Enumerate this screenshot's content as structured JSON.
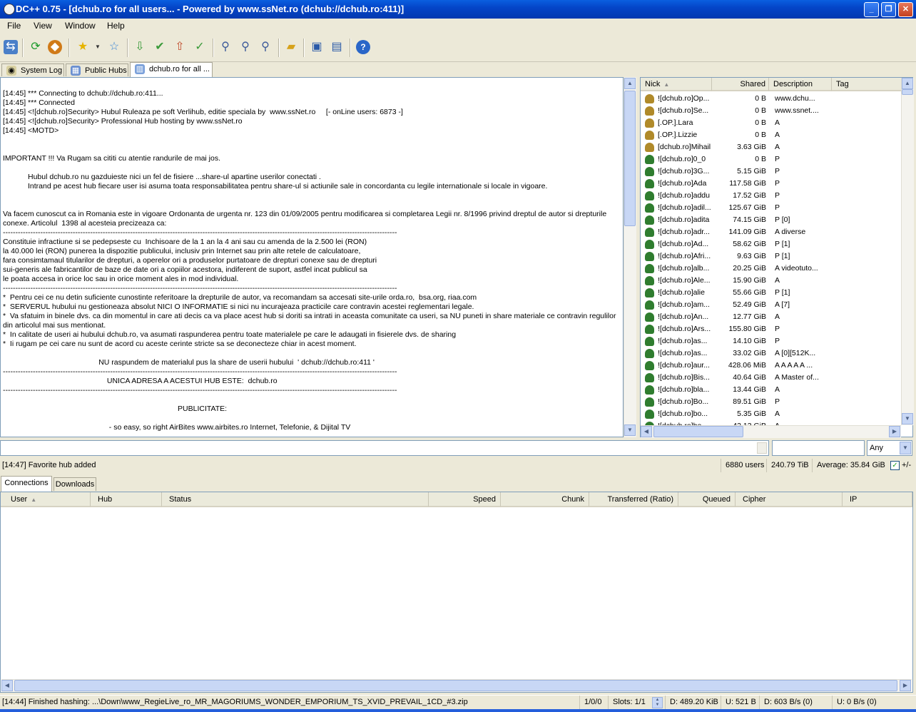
{
  "window": {
    "title": "DC++ 0.75 - [dchub.ro for all users... - Powered by www.ssNet.ro  (dchub://dchub.ro:411)]",
    "minimize": "_",
    "restore": "❐",
    "close": "✕"
  },
  "menu": [
    "File",
    "View",
    "Window",
    "Help"
  ],
  "tabs": [
    {
      "label": "System Log",
      "icon": "log-icon"
    },
    {
      "label": "Public Hubs",
      "icon": "hubs-icon"
    },
    {
      "label": "dchub.ro for all ...",
      "icon": "hub-icon"
    }
  ],
  "chat": {
    "lines": [
      "[14:45] *** Connecting to dchub://dchub.ro:411...",
      "[14:45] *** Connected",
      "[14:45] <![dchub.ro]Security> Hubul Ruleaza pe soft Verlihub, editie speciala by  www.ssNet.ro     [- onLine users: 6873 -]",
      "[14:45] <![dchub.ro]Security> Professional Hub hosting by www.ssNet.ro",
      "[14:45] <MOTD>",
      "",
      "IMPORTANT !!! Va Rugam sa cititi cu atentie randurile de mai jos.",
      "",
      "            Hubul dchub.ro nu gazduieste nici un fel de fisiere ...share-ul apartine userilor conectati .",
      "            Intrand pe acest hub fiecare user isi asuma toata responsabilitatea pentru share-ul si actiunile sale in concordanta cu legile internationale si locale in vigoare.",
      "",
      "",
      "Va facem cunoscut ca in Romania este in vigoare Ordonanta de urgenta nr. 123 din 01/09/2005 pentru modificarea si completarea Legii nr. 8/1996 privind dreptul de autor si drepturile",
      "conexe. Articolul  1398 al acesteia precizeaza ca:",
      "--------------------------------------------------------------------------------------------------------------------------------------------------------------",
      "Constituie infractiune si se pedepseste cu  Inchisoare de la 1 an la 4 ani sau cu amenda de la 2.500 lei (RON)",
      "la 40.000 lei (RON) punerea la dispozitie publicului, inclusiv prin Internet sau prin alte retele de calculatoare,",
      "fara consimtamaul titularilor de drepturi, a operelor ori a produselor purtatoare de drepturi conexe sau de drepturi",
      "sui-generis ale fabricantilor de baze de date ori a copiilor acestora, indiferent de suport, astfel incat publicul sa",
      "le poata accesa in orice loc sau in orice moment ales in mod individual.",
      "--------------------------------------------------------------------------------------------------------------------------------------------------------------",
      "*  Pentru cei ce nu detin suficiente cunostinte referitoare la drepturile de autor, va recomandam sa accesati site-urile orda.ro,  bsa.org, riaa.com",
      "*  SERVERUL hubului nu gestioneaza absolut NICI O INFORMATIE si nici nu incurajeaza practicile care contravin acestei reglementari legale.",
      "*  Va sfatuim in binele dvs. ca din momentul in care ati decis ca va place acest hub si doriti sa intrati in aceasta comunitate ca useri, sa NU puneti in share materiale ce contravin regulilor",
      "din articolul mai sus mentionat.",
      "*  In calitate de useri ai hubului dchub.ro, va asumati raspunderea pentru toate materialele pe care le adaugati in fisierele dvs. de sharing",
      "*  Ii rugam pe cei care nu sunt de acord cu aceste cerinte stricte sa se deconecteze chiar in acest moment.",
      "",
      "                                              NU raspundem de materialul pus la share de userii hubului  ' dchub://dchub.ro:411 '",
      "--------------------------------------------------------------------------------------------------------------------------------------------------------------",
      "                                                  UNICA ADRESA A ACESTUI HUB ESTE:  dchub.ro",
      "--------------------------------------------------------------------------------------------------------------------------------------------------------------",
      "",
      "                                                                                    PUBLICITATE:",
      "",
      "                                                   - so easy, so right AirBites www.airbites.ro Internet, Telefonie, & Dijital TV"
    ]
  },
  "userlist": {
    "columns": [
      "Nick",
      "Shared",
      "Description",
      "Tag"
    ],
    "rows": [
      {
        "nick": "![dchub.ro]Op...",
        "shared": "0 B",
        "desc": "www.dchu...",
        "op": true
      },
      {
        "nick": "![dchub.ro]Se...",
        "shared": "0 B",
        "desc": "www.ssnet....",
        "op": true
      },
      {
        "nick": "[.OP.].Lara",
        "shared": "0 B",
        "desc": "A",
        "op": true
      },
      {
        "nick": "[.OP.].Lizzie",
        "shared": "0 B",
        "desc": "A",
        "op": true
      },
      {
        "nick": "[dchub.ro]Mihail",
        "shared": "3.63 GiB",
        "desc": "A",
        "op": true
      },
      {
        "nick": "![dchub.ro]0_0",
        "shared": "0 B",
        "desc": "P",
        "op": false
      },
      {
        "nick": "![dchub.ro]3G...",
        "shared": "5.15 GiB",
        "desc": "P",
        "op": false
      },
      {
        "nick": "![dchub.ro]Ada",
        "shared": "117.58 GiB",
        "desc": "P",
        "op": false
      },
      {
        "nick": "![dchub.ro]addu",
        "shared": "17.52 GiB",
        "desc": "P",
        "op": false
      },
      {
        "nick": "![dchub.ro]adil...",
        "shared": "125.67 GiB",
        "desc": "P",
        "op": false
      },
      {
        "nick": "![dchub.ro]adita",
        "shared": "74.15 GiB",
        "desc": "P [0]",
        "op": false
      },
      {
        "nick": "![dchub.ro]adr...",
        "shared": "141.09 GiB",
        "desc": "A diverse",
        "op": false
      },
      {
        "nick": "![dchub.ro]Ad...",
        "shared": "58.62 GiB",
        "desc": "P [1]",
        "op": false
      },
      {
        "nick": "![dchub.ro]Afri...",
        "shared": "9.63 GiB",
        "desc": "P [1]",
        "op": false
      },
      {
        "nick": "![dchub.ro]alb...",
        "shared": "20.25 GiB",
        "desc": "A videotuto...",
        "op": false
      },
      {
        "nick": "![dchub.ro]Ale...",
        "shared": "15.90 GiB",
        "desc": "A",
        "op": false
      },
      {
        "nick": "![dchub.ro]alie",
        "shared": "55.66 GiB",
        "desc": "P [1]",
        "op": false
      },
      {
        "nick": "![dchub.ro]am...",
        "shared": "52.49 GiB",
        "desc": "A [7]",
        "op": false
      },
      {
        "nick": "![dchub.ro]An...",
        "shared": "12.77 GiB",
        "desc": "A",
        "op": false
      },
      {
        "nick": "![dchub.ro]Ars...",
        "shared": "155.80 GiB",
        "desc": "P",
        "op": false
      },
      {
        "nick": "![dchub.ro]as...",
        "shared": "14.10 GiB",
        "desc": "P",
        "op": false
      },
      {
        "nick": "![dchub.ro]as...",
        "shared": "33.02 GiB",
        "desc": "A [0][512K...",
        "op": false
      },
      {
        "nick": "![dchub.ro]aur...",
        "shared": "428.06 MiB",
        "desc": "A A A A A ...",
        "op": false
      },
      {
        "nick": "![dchub.ro]Bis...",
        "shared": "40.64 GiB",
        "desc": "A Master of...",
        "op": false
      },
      {
        "nick": "![dchub.ro]bla...",
        "shared": "13.44 GiB",
        "desc": "A",
        "op": false
      },
      {
        "nick": "![dchub.ro]Bo...",
        "shared": "89.51 GiB",
        "desc": "P",
        "op": false
      },
      {
        "nick": "![dchub.ro]bo...",
        "shared": "5.35 GiB",
        "desc": "A",
        "op": false
      },
      {
        "nick": "![dchub.ro]bo...",
        "shared": "42.13 GiB",
        "desc": "A",
        "op": false
      }
    ]
  },
  "search": {
    "type_selected": "Any"
  },
  "hubstatus": {
    "message": "[14:47] Favorite hub added",
    "users": "6880 users",
    "total_shared": "240.79 TiB",
    "average": "Average: 35.84 GiB",
    "toggle_label": "+/-"
  },
  "bottom_tabs": [
    "Connections",
    "Downloads"
  ],
  "transfers": {
    "columns": [
      "User",
      "Hub",
      "Status",
      "Speed",
      "Chunk",
      "Transferred (Ratio)",
      "Queued",
      "Cipher",
      "IP"
    ]
  },
  "statusbar": {
    "message": "[14:44] Finished hashing: ...\\Down\\www_RegieLive_ro_MR_MAGORIUMS_WONDER_EMPORIUM_TS_XVID_PREVAIL_1CD_#3.zip",
    "hubs": "1/0/0",
    "slots": "Slots: 1/1",
    "downloaded": "D: 489.20 KiB",
    "uploaded": "U: 521 B",
    "down_rate": "D: 603 B/s (0)",
    "up_rate": "U: 0 B/s (0)"
  }
}
